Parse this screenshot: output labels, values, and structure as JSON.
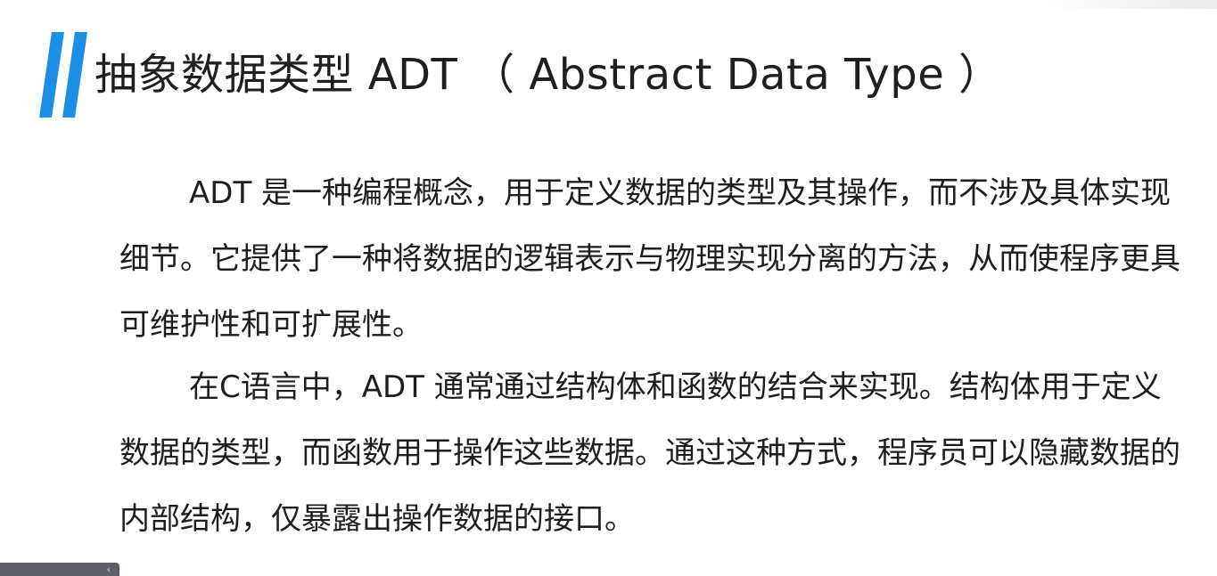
{
  "slide": {
    "title": "抽象数据类型 ADT （ Abstract Data Type ）",
    "accent_color": "#1a8fe3",
    "paragraphs": [
      "ADT 是一种编程概念，用于定义数据的类型及其操作，而不涉及具体实现细节。它提供了一种将数据的逻辑表示与物理实现分离的方法，从而使程序更具可维护性和可扩展性。",
      "在C语言中，ADT 通常通过结构体和函数的结合来实现。结构体用于定义数据的类型，而函数用于操作这些数据。通过这种方式，程序员可以隐藏数据的内部结构，仅暴露出操作数据的接口。"
    ]
  },
  "player_bar": {
    "chevron_icon": "chevron-left-icon"
  }
}
